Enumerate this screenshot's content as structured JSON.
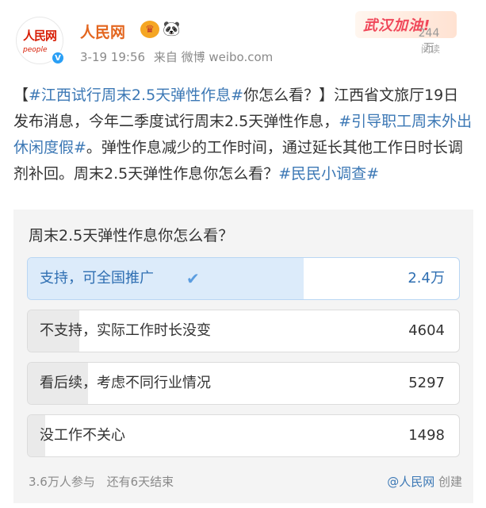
{
  "post": {
    "author": "人民网",
    "avatar_text": "人民网",
    "avatar_sub": "people",
    "verified_badge": "V",
    "time": "3-19 19:56",
    "source": "来自 微博 weibo.com",
    "banner": "武汉加油!",
    "views": "244万",
    "views_label": "阅读",
    "content": {
      "p1": "【",
      "tag1": "#江西试行周末2.5天弹性作息#",
      "p2": "你怎么看？】江西省文旅厅19日发布消息，今年二季度试行周末2.5天弹性作息，",
      "tag2": "#引导职工周末外出休闲度假#",
      "p3": "。弹性作息减少的工作时间，通过延长其他工作日时长调剂补回。周末2.5天弹性作息你怎么看？",
      "tag3": "#民民小调查#"
    }
  },
  "poll": {
    "title": "周末2.5天弹性作息你怎么看？",
    "options": [
      {
        "label": "支持，可全国推广",
        "count": "2.4万",
        "share": 0.64,
        "selected": true
      },
      {
        "label": "不支持，实际工作时长没变",
        "count": "4604",
        "share": 0.12,
        "selected": false
      },
      {
        "label": "看后续，考虑不同行业情况",
        "count": "5297",
        "share": 0.14,
        "selected": false
      },
      {
        "label": "没工作不关心",
        "count": "1498",
        "share": 0.04,
        "selected": false
      }
    ],
    "participants": "3.6万人参与",
    "remaining": "还有6天结束",
    "creator_name": "@人民网",
    "creator_suffix": "创建"
  }
}
